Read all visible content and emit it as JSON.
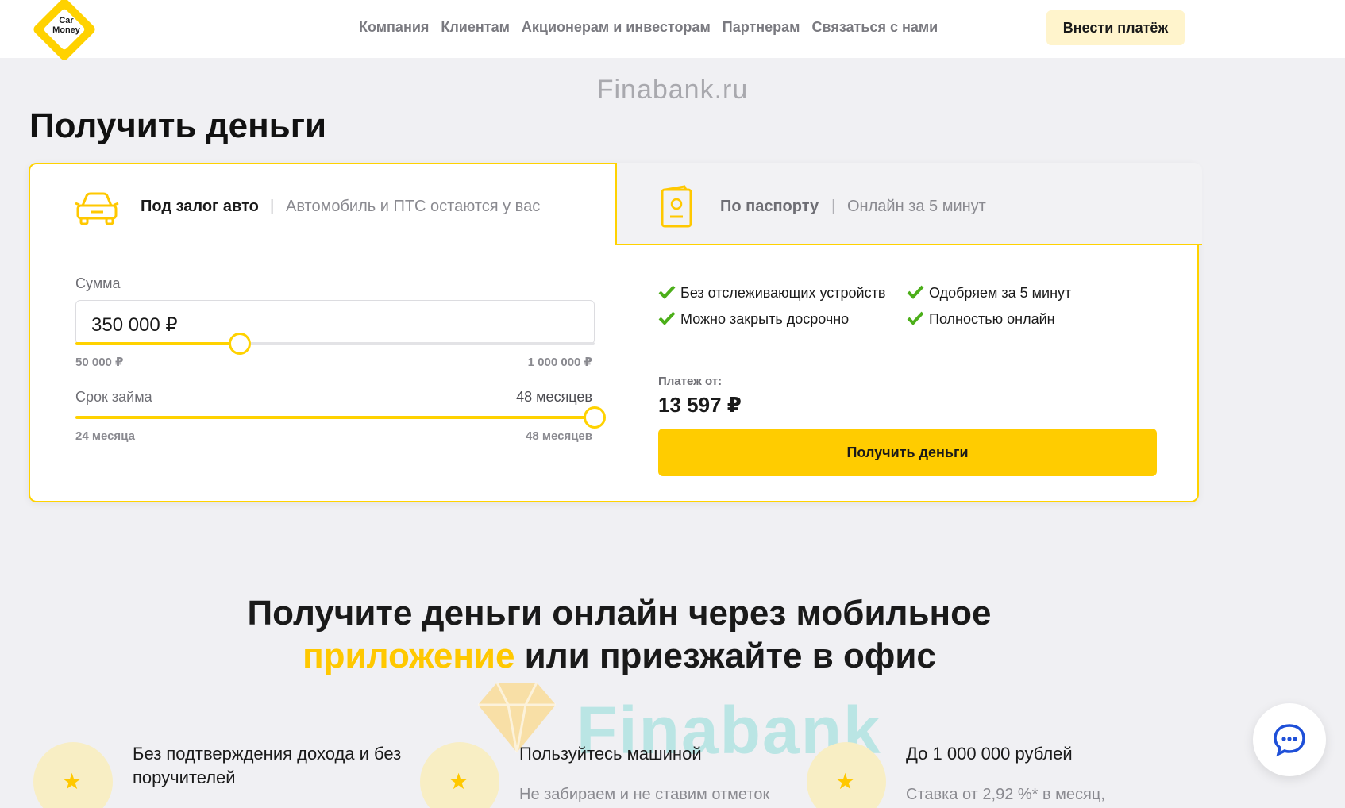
{
  "header": {
    "logo_line1": "Car",
    "logo_line2": "Money",
    "nav": [
      "Компания",
      "Клиентам",
      "Акционерам и инвесторам",
      "Партнерам",
      "Связаться с нами"
    ],
    "pay_button": "Внести платёж"
  },
  "watermark_top": "Finabank.ru",
  "page_title": "Получить деньги",
  "tabs": {
    "auto": {
      "label": "Под залог авто",
      "sep": "|",
      "sub": "Автомобиль и ПТС остаются у вас"
    },
    "passport": {
      "label": "По паспорту",
      "sep": "|",
      "sub": "Онлайн за 5 минут"
    }
  },
  "calculator": {
    "sum_label": "Сумма",
    "sum_value": "350 000 ₽",
    "sum_min": "50 000 ₽",
    "sum_max": "1 000 000 ₽",
    "sum_fraction": 0.316,
    "term_label": "Срок займа",
    "term_value": "48 месяцев",
    "term_min": "24 месяца",
    "term_max": "48 месяцев",
    "term_fraction": 1.0
  },
  "features": [
    "Без отслеживающих устройств",
    "Одобряем за 5 минут",
    "Можно закрыть досрочно",
    "Полностью онлайн"
  ],
  "payment": {
    "label": "Платеж от:",
    "value": "13 597 ₽"
  },
  "get_money_button": "Получить деньги",
  "section": {
    "line1": "Получите деньги онлайн через мобильное",
    "highlight": "приложение",
    "line2_rest": " или приезжайте в офис"
  },
  "watermark_bottom": "Finabank",
  "benefits": [
    {
      "title": "Без подтверждения дохода и без поручителей",
      "desc": ""
    },
    {
      "title": "Пользуйтесь машиной",
      "desc": "Не забираем и не ставим отметок"
    },
    {
      "title": "До 1 000 000 рублей",
      "desc": "Ставка от 2,92 %* в месяц,"
    }
  ],
  "colors": {
    "accent": "#ffd200",
    "button": "#ffcc00",
    "check": "#4caf1a"
  },
  "icons": [
    "car-icon",
    "passport-icon",
    "check-icon",
    "star-icon",
    "chat-icon"
  ]
}
